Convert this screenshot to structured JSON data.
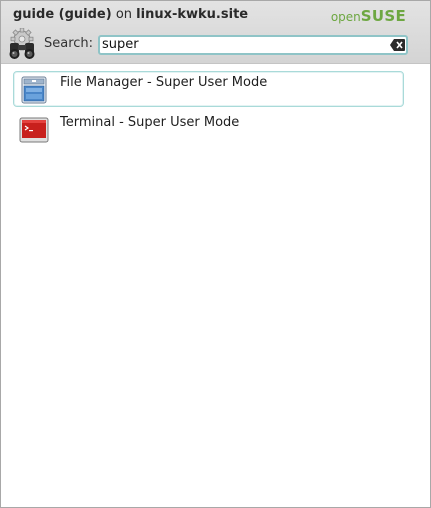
{
  "header": {
    "user_name": "guide (guide)",
    "on_text": "on",
    "host": "linux-kwku.site",
    "brand_light": "open",
    "brand_heavy": "SUSE",
    "brand_color": "#6da741"
  },
  "search": {
    "label": "Search:",
    "value": "super",
    "icon": "binoculars-icon",
    "clear_icon": "clear-text-icon"
  },
  "results": [
    {
      "label": "File Manager - Super User Mode",
      "icon": "file-manager-icon",
      "selected": true
    },
    {
      "label": "Terminal - Super User Mode",
      "icon": "terminal-icon",
      "selected": false
    }
  ]
}
